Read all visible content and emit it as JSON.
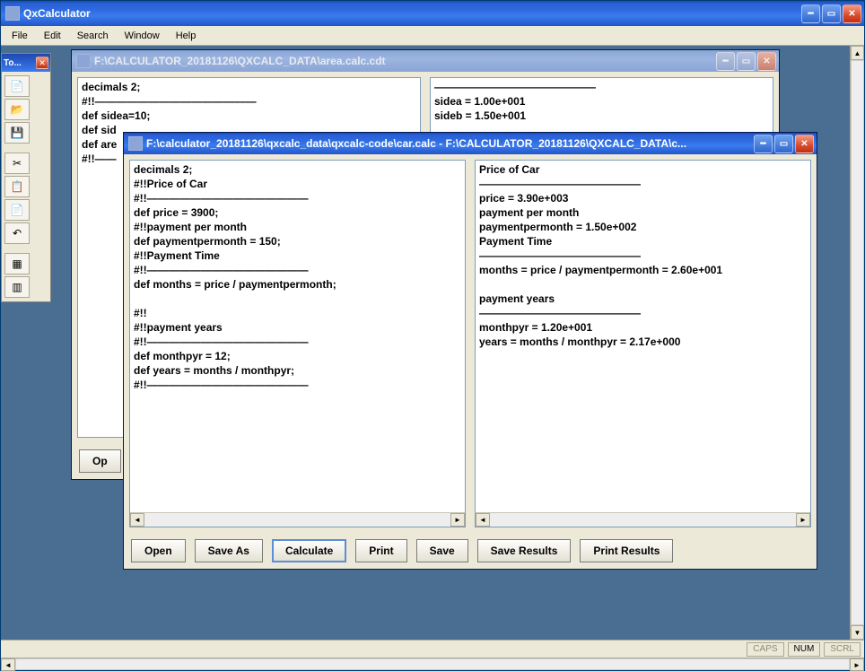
{
  "app": {
    "title": "QxCalculator"
  },
  "menu": {
    "file": "File",
    "edit": "Edit",
    "search": "Search",
    "window": "Window",
    "help": "Help"
  },
  "status": {
    "caps": "CAPS",
    "num": "NUM",
    "scrl": "SCRL"
  },
  "toolbox": {
    "title": "To..."
  },
  "child1": {
    "title": "F:\\CALCULATOR_20181126\\QXCALC_DATA\\area.calc.cdt",
    "left_lines": [
      "decimals 2;",
      "#!!———————————————",
      "def sidea=10;",
      "def sid",
      "def are",
      "#!!——"
    ],
    "right_lines": [
      "———————————————",
      "sidea = 1.00e+001",
      "sideb = 1.50e+001"
    ],
    "open": "Op"
  },
  "child2": {
    "title": "F:\\calculator_20181126\\qxcalc_data\\qxcalc-code\\car.calc - F:\\CALCULATOR_20181126\\QXCALC_DATA\\c...",
    "left_lines": [
      "decimals 2;",
      "#!!Price of Car",
      "#!!———————————————",
      "def price = 3900;",
      "#!!payment per month",
      "def paymentpermonth = 150;",
      "#!!Payment Time",
      "#!!———————————————",
      "def months = price / paymentpermonth;",
      "",
      "#!!",
      "#!!payment years",
      "#!!———————————————",
      "def monthpyr = 12;",
      "def years = months / monthpyr;",
      "#!!———————————————"
    ],
    "right_lines": [
      "Price of Car",
      "———————————————",
      "price = 3.90e+003",
      "payment per month",
      "paymentpermonth = 1.50e+002",
      "Payment Time",
      "———————————————",
      "months = price / paymentpermonth = 2.60e+001",
      "",
      "payment years",
      "———————————————",
      "monthpyr = 1.20e+001",
      "years = months / monthpyr = 2.17e+000"
    ],
    "buttons": {
      "open": "Open",
      "saveas": "Save As",
      "calculate": "Calculate",
      "print": "Print",
      "save": "Save",
      "saveresults": "Save Results",
      "printresults": "Print Results"
    }
  }
}
